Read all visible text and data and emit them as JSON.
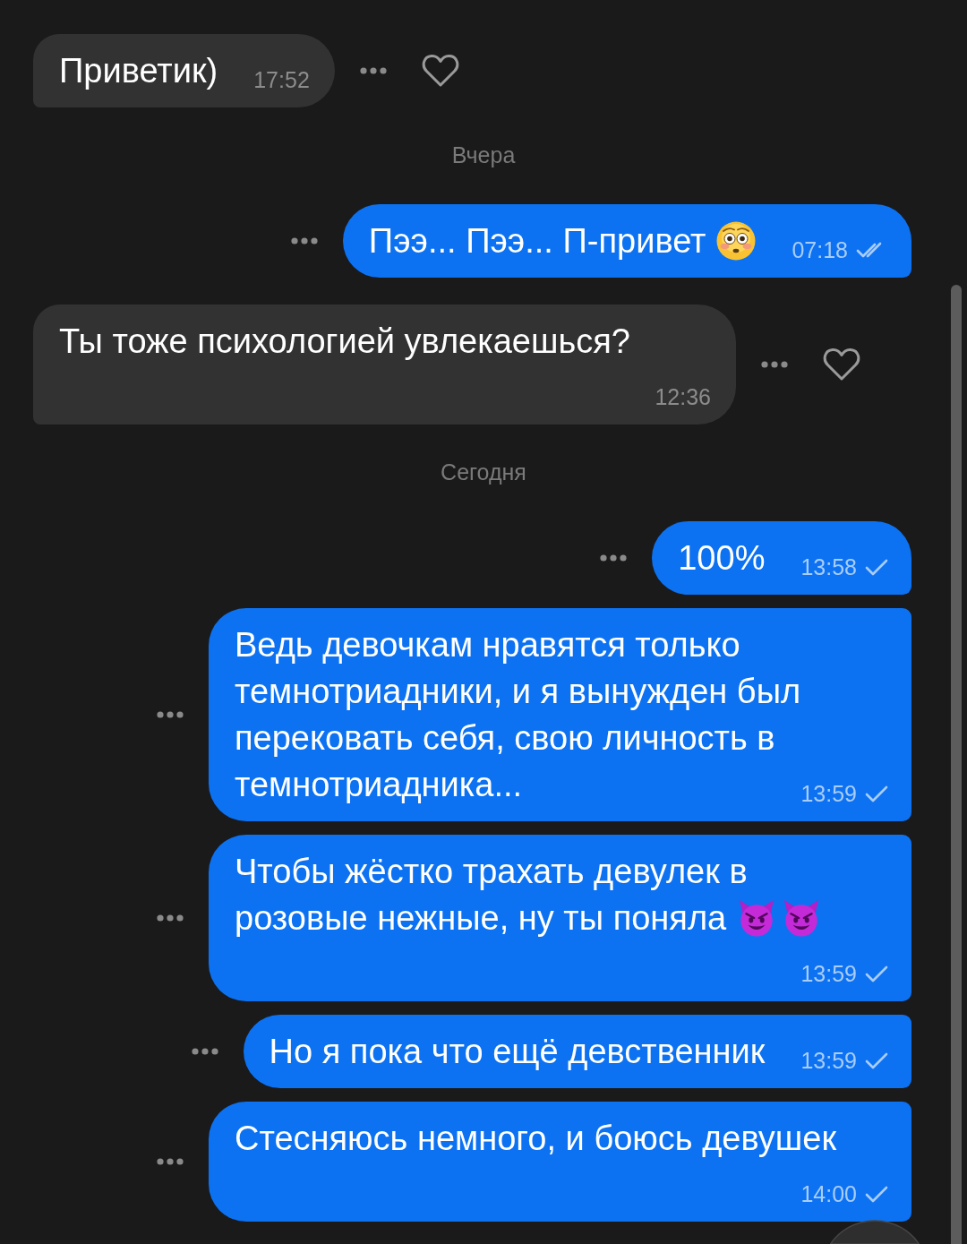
{
  "messages": [
    {
      "kind": "incoming",
      "text": "Приветик)",
      "time": "17:52",
      "liked": false
    },
    {
      "kind": "date",
      "text": "Вчера"
    },
    {
      "kind": "outgoing",
      "text": "Пээ... Пээ... П-привет",
      "emoji": [
        {
          "kind": "flushed"
        }
      ],
      "time": "07:18",
      "read": true
    },
    {
      "kind": "incoming",
      "text": "Ты тоже психологией увлекаешься?",
      "time": "12:36",
      "liked": false
    },
    {
      "kind": "date",
      "text": "Сегодня"
    },
    {
      "kind": "outgoing",
      "text": "100%",
      "time": "13:58",
      "read": false
    },
    {
      "kind": "outgoing",
      "text": "Ведь девочкам нравятся только темнотриадники, и я вынужден был перековать себя, свою личность в темнотриадника...",
      "time": "13:59",
      "read": false
    },
    {
      "kind": "outgoing",
      "text": "Чтобы жёстко трахать девулек в розовые нежные, ну ты поняла",
      "emoji": [
        {
          "kind": "devil"
        },
        {
          "kind": "devil"
        }
      ],
      "time": "13:59",
      "read": false
    },
    {
      "kind": "outgoing",
      "text": "Но я пока что ещё девственник",
      "time": "13:59",
      "read": false
    },
    {
      "kind": "outgoing",
      "text": "Стесняюсь немного, и боюсь девушек",
      "time": "14:00",
      "read": false
    }
  ]
}
